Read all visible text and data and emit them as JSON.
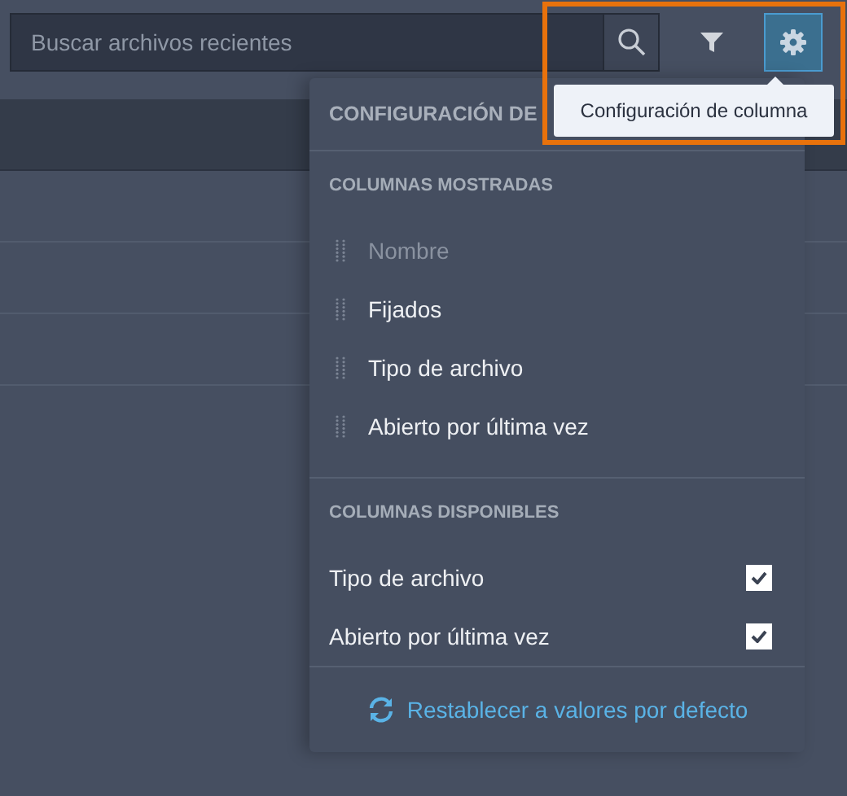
{
  "search": {
    "placeholder": "Buscar archivos recientes"
  },
  "toolbar": {
    "settings_button": {
      "selected": true
    }
  },
  "tooltip": "Configuración de columna",
  "menu": {
    "title": "CONFIGURACIÓN DE",
    "shown_heading": "COLUMNAS MOSTRADAS",
    "shown_columns": [
      {
        "label": "Nombre",
        "disabled": true
      },
      {
        "label": "Fijados",
        "disabled": false
      },
      {
        "label": "Tipo de archivo",
        "disabled": false
      },
      {
        "label": "Abierto por última vez",
        "disabled": false
      }
    ],
    "available_heading": "COLUMNAS DISPONIBLES",
    "available_columns": [
      {
        "label": "Tipo de archivo",
        "checked": true
      },
      {
        "label": "Abierto por última vez",
        "checked": true
      }
    ],
    "reset_link": "Restablecer a valores por defecto"
  },
  "highlight": {
    "on": true
  }
}
